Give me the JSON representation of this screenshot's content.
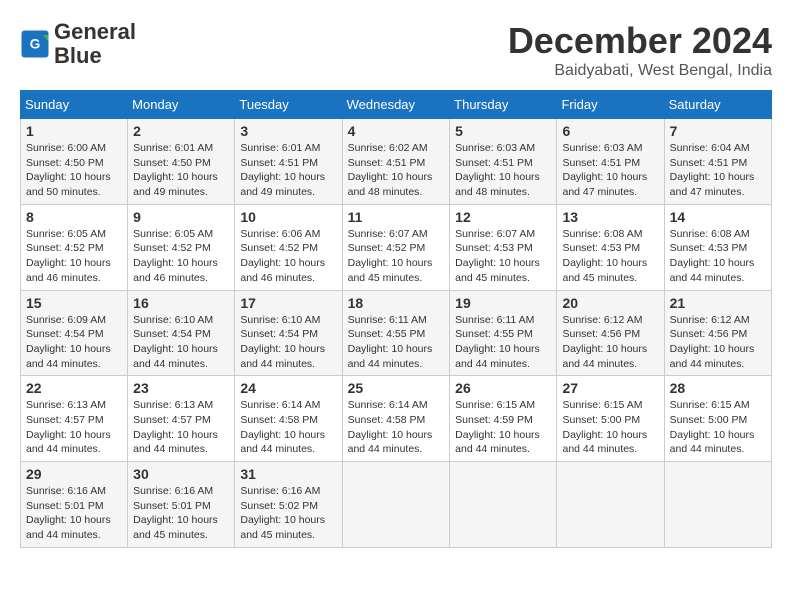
{
  "header": {
    "logo_line1": "General",
    "logo_line2": "Blue",
    "month_title": "December 2024",
    "location": "Baidyabati, West Bengal, India"
  },
  "calendar": {
    "headers": [
      "Sunday",
      "Monday",
      "Tuesday",
      "Wednesday",
      "Thursday",
      "Friday",
      "Saturday"
    ],
    "weeks": [
      [
        {
          "day": "1",
          "info": "Sunrise: 6:00 AM\nSunset: 4:50 PM\nDaylight: 10 hours\nand 50 minutes."
        },
        {
          "day": "2",
          "info": "Sunrise: 6:01 AM\nSunset: 4:50 PM\nDaylight: 10 hours\nand 49 minutes."
        },
        {
          "day": "3",
          "info": "Sunrise: 6:01 AM\nSunset: 4:51 PM\nDaylight: 10 hours\nand 49 minutes."
        },
        {
          "day": "4",
          "info": "Sunrise: 6:02 AM\nSunset: 4:51 PM\nDaylight: 10 hours\nand 48 minutes."
        },
        {
          "day": "5",
          "info": "Sunrise: 6:03 AM\nSunset: 4:51 PM\nDaylight: 10 hours\nand 48 minutes."
        },
        {
          "day": "6",
          "info": "Sunrise: 6:03 AM\nSunset: 4:51 PM\nDaylight: 10 hours\nand 47 minutes."
        },
        {
          "day": "7",
          "info": "Sunrise: 6:04 AM\nSunset: 4:51 PM\nDaylight: 10 hours\nand 47 minutes."
        }
      ],
      [
        {
          "day": "8",
          "info": "Sunrise: 6:05 AM\nSunset: 4:52 PM\nDaylight: 10 hours\nand 46 minutes."
        },
        {
          "day": "9",
          "info": "Sunrise: 6:05 AM\nSunset: 4:52 PM\nDaylight: 10 hours\nand 46 minutes."
        },
        {
          "day": "10",
          "info": "Sunrise: 6:06 AM\nSunset: 4:52 PM\nDaylight: 10 hours\nand 46 minutes."
        },
        {
          "day": "11",
          "info": "Sunrise: 6:07 AM\nSunset: 4:52 PM\nDaylight: 10 hours\nand 45 minutes."
        },
        {
          "day": "12",
          "info": "Sunrise: 6:07 AM\nSunset: 4:53 PM\nDaylight: 10 hours\nand 45 minutes."
        },
        {
          "day": "13",
          "info": "Sunrise: 6:08 AM\nSunset: 4:53 PM\nDaylight: 10 hours\nand 45 minutes."
        },
        {
          "day": "14",
          "info": "Sunrise: 6:08 AM\nSunset: 4:53 PM\nDaylight: 10 hours\nand 44 minutes."
        }
      ],
      [
        {
          "day": "15",
          "info": "Sunrise: 6:09 AM\nSunset: 4:54 PM\nDaylight: 10 hours\nand 44 minutes."
        },
        {
          "day": "16",
          "info": "Sunrise: 6:10 AM\nSunset: 4:54 PM\nDaylight: 10 hours\nand 44 minutes."
        },
        {
          "day": "17",
          "info": "Sunrise: 6:10 AM\nSunset: 4:54 PM\nDaylight: 10 hours\nand 44 minutes."
        },
        {
          "day": "18",
          "info": "Sunrise: 6:11 AM\nSunset: 4:55 PM\nDaylight: 10 hours\nand 44 minutes."
        },
        {
          "day": "19",
          "info": "Sunrise: 6:11 AM\nSunset: 4:55 PM\nDaylight: 10 hours\nand 44 minutes."
        },
        {
          "day": "20",
          "info": "Sunrise: 6:12 AM\nSunset: 4:56 PM\nDaylight: 10 hours\nand 44 minutes."
        },
        {
          "day": "21",
          "info": "Sunrise: 6:12 AM\nSunset: 4:56 PM\nDaylight: 10 hours\nand 44 minutes."
        }
      ],
      [
        {
          "day": "22",
          "info": "Sunrise: 6:13 AM\nSunset: 4:57 PM\nDaylight: 10 hours\nand 44 minutes."
        },
        {
          "day": "23",
          "info": "Sunrise: 6:13 AM\nSunset: 4:57 PM\nDaylight: 10 hours\nand 44 minutes."
        },
        {
          "day": "24",
          "info": "Sunrise: 6:14 AM\nSunset: 4:58 PM\nDaylight: 10 hours\nand 44 minutes."
        },
        {
          "day": "25",
          "info": "Sunrise: 6:14 AM\nSunset: 4:58 PM\nDaylight: 10 hours\nand 44 minutes."
        },
        {
          "day": "26",
          "info": "Sunrise: 6:15 AM\nSunset: 4:59 PM\nDaylight: 10 hours\nand 44 minutes."
        },
        {
          "day": "27",
          "info": "Sunrise: 6:15 AM\nSunset: 5:00 PM\nDaylight: 10 hours\nand 44 minutes."
        },
        {
          "day": "28",
          "info": "Sunrise: 6:15 AM\nSunset: 5:00 PM\nDaylight: 10 hours\nand 44 minutes."
        }
      ],
      [
        {
          "day": "29",
          "info": "Sunrise: 6:16 AM\nSunset: 5:01 PM\nDaylight: 10 hours\nand 44 minutes."
        },
        {
          "day": "30",
          "info": "Sunrise: 6:16 AM\nSunset: 5:01 PM\nDaylight: 10 hours\nand 45 minutes."
        },
        {
          "day": "31",
          "info": "Sunrise: 6:16 AM\nSunset: 5:02 PM\nDaylight: 10 hours\nand 45 minutes."
        },
        {
          "day": "",
          "info": ""
        },
        {
          "day": "",
          "info": ""
        },
        {
          "day": "",
          "info": ""
        },
        {
          "day": "",
          "info": ""
        }
      ]
    ]
  }
}
